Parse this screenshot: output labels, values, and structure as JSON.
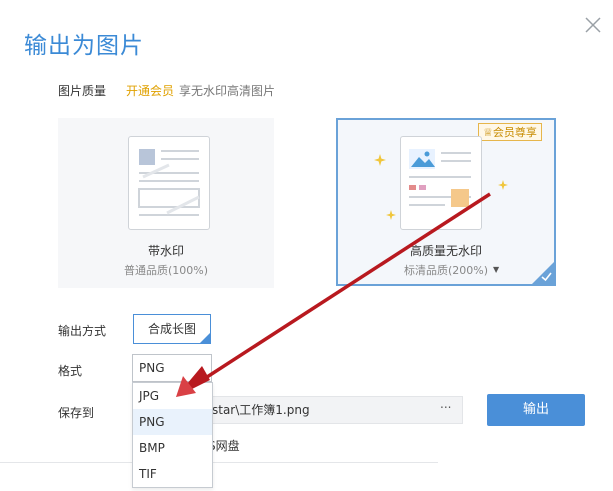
{
  "dialog": {
    "title": "输出为图片",
    "quality_label": "图片质量",
    "vip_link": "开通会员",
    "vip_desc": "享无水印高清图片"
  },
  "cards": [
    {
      "name": "带水印",
      "sub": "普通品质(100%)"
    },
    {
      "name": "高质量无水印",
      "sub": "标清品质(200%)",
      "badge": "会员尊享"
    }
  ],
  "output": {
    "label": "输出方式",
    "value": "合成长图"
  },
  "format": {
    "label": "格式",
    "selected": "PNG",
    "options": [
      "JPG",
      "PNG",
      "BMP",
      "TIF"
    ]
  },
  "save": {
    "label": "保存到",
    "path": "star\\工作簿1.png",
    "browse": "...",
    "cloud": "S网盘"
  },
  "export_button": "输出",
  "colors": {
    "accent": "#4a8fd8",
    "vip": "#e0a100",
    "arrow": "#b8191f"
  }
}
